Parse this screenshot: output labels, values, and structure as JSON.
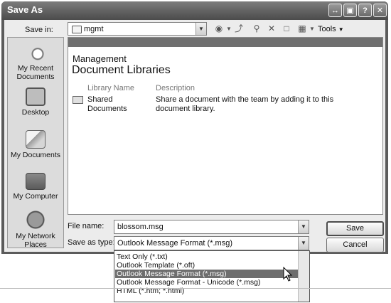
{
  "window": {
    "title": "Save As"
  },
  "save_in": {
    "label": "Save in:",
    "value": "mgmt"
  },
  "toolbar": {
    "tools_label": "Tools"
  },
  "places": [
    {
      "label": "My Recent Documents",
      "icon": "recent-documents-icon"
    },
    {
      "label": "Desktop",
      "icon": "desktop-icon"
    },
    {
      "label": "My Documents",
      "icon": "my-documents-icon"
    },
    {
      "label": "My Computer",
      "icon": "my-computer-icon"
    },
    {
      "label": "My Network Places",
      "icon": "network-places-icon"
    }
  ],
  "view": {
    "site_name": "Management",
    "heading": "Document Libraries",
    "columns": [
      "Library Name",
      "Description"
    ],
    "rows": [
      {
        "name": "Shared Documents",
        "description": "Share a document with the team by adding it to this document library."
      }
    ]
  },
  "file_name": {
    "label": "File name:",
    "value": "blossom.msg"
  },
  "save_as_type": {
    "label": "Save as type:",
    "value": "Outlook Message Format (*.msg)",
    "options": [
      "Text Only (*.txt)",
      "Outlook Template (*.oft)",
      "Outlook Message Format (*.msg)",
      "Outlook Message Format - Unicode (*.msg)",
      "HTML (*.htm; *.html)"
    ]
  },
  "buttons": {
    "save": "Save",
    "cancel": "Cancel"
  }
}
